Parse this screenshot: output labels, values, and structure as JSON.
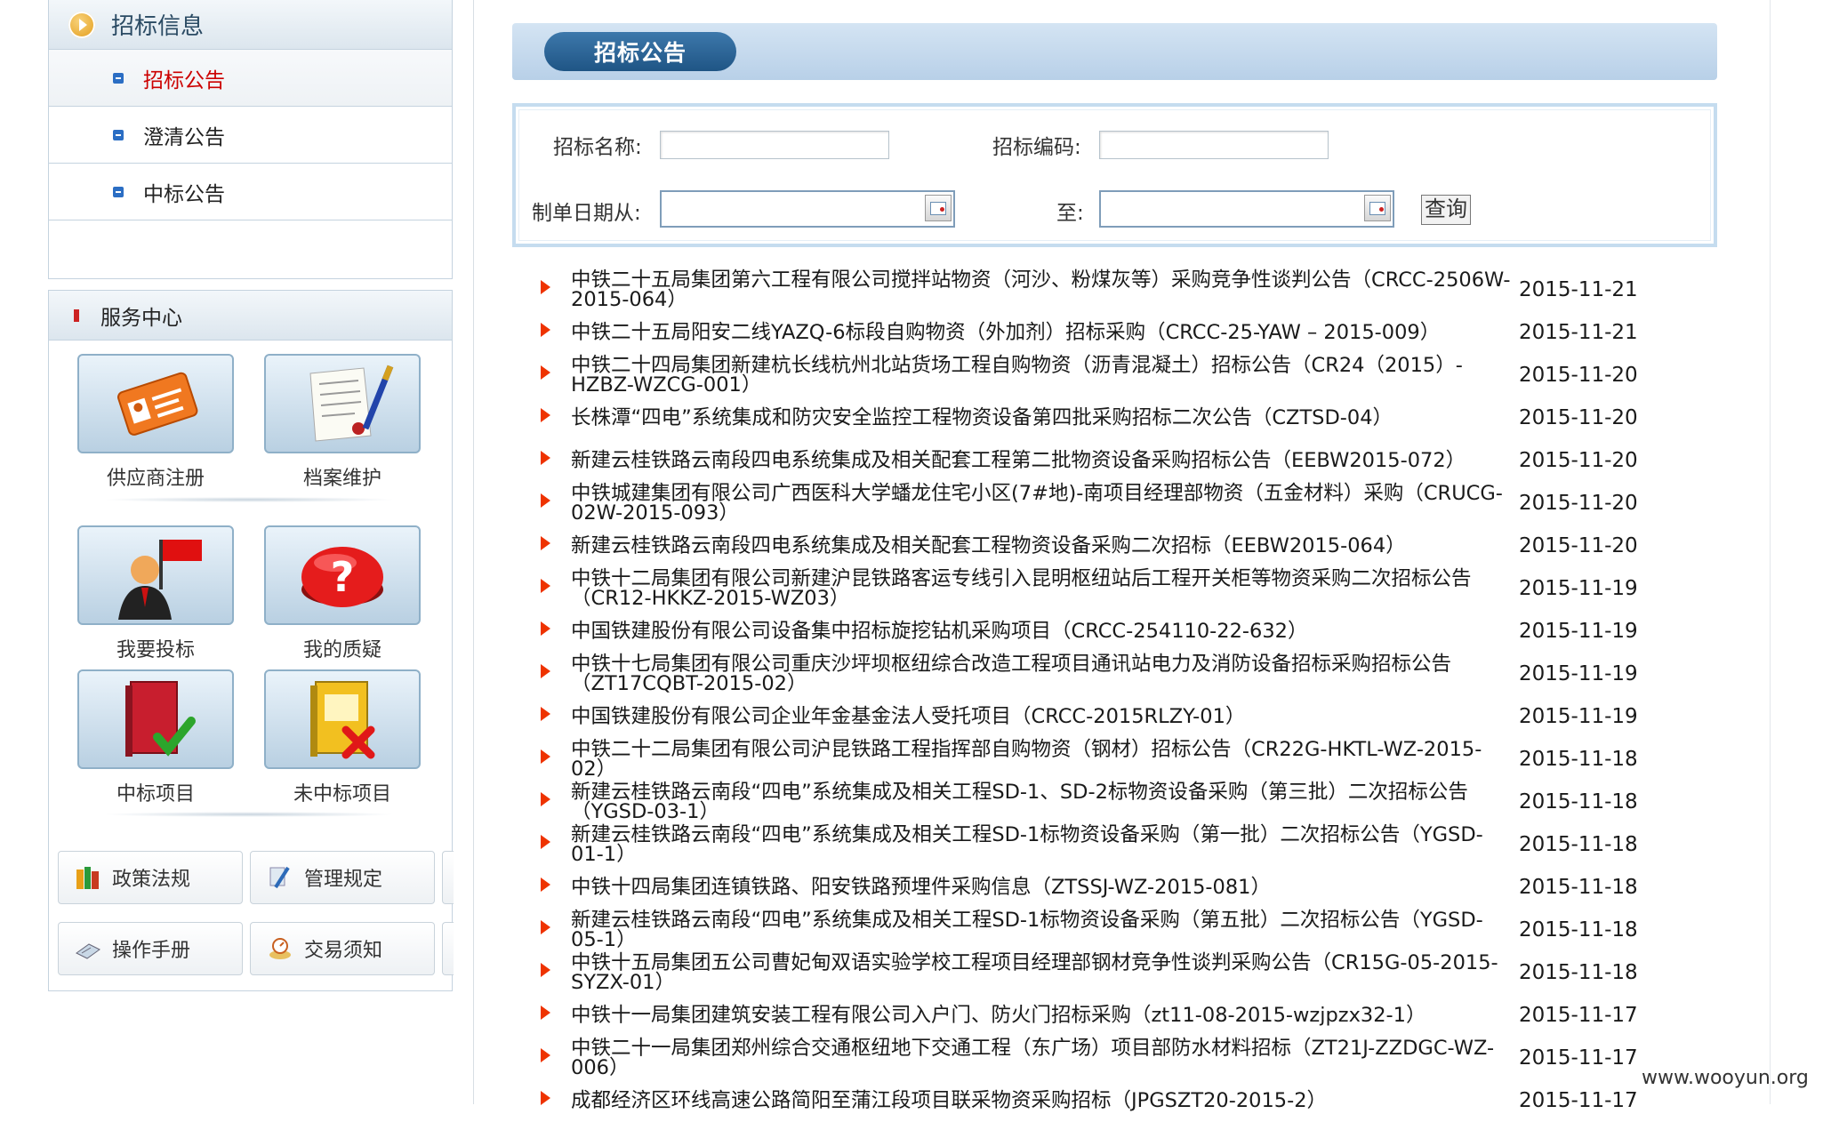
{
  "sidebar": {
    "section_title": "招标信息",
    "items": [
      {
        "label": "招标公告",
        "active": true
      },
      {
        "label": "澄清公告",
        "active": false
      },
      {
        "label": "中标公告",
        "active": false
      }
    ],
    "service_title": "服务中心",
    "services": [
      {
        "label": "供应商注册",
        "icon": "id-card-icon"
      },
      {
        "label": "档案维护",
        "icon": "document-pen-icon"
      },
      {
        "label": "我要投标",
        "icon": "person-flag-icon"
      },
      {
        "label": "我的质疑",
        "icon": "question-button-icon"
      },
      {
        "label": "中标项目",
        "icon": "book-check-icon"
      },
      {
        "label": "未中标项目",
        "icon": "book-cross-icon"
      }
    ],
    "links": [
      {
        "label": "政策法规",
        "icon": "books-icon"
      },
      {
        "label": "管理规定",
        "icon": "pen-icon"
      },
      {
        "label": "操作手册",
        "icon": "manual-icon"
      },
      {
        "label": "交易须知",
        "icon": "notice-icon"
      }
    ]
  },
  "main": {
    "banner_title": "招标公告",
    "search": {
      "name_label": "招标名称:",
      "code_label": "招标编码:",
      "date_from_label": "制单日期从:",
      "date_to_label": "至:",
      "query_button": "查询",
      "name_value": "",
      "code_value": "",
      "date_from_value": "",
      "date_to_value": ""
    },
    "notices": [
      {
        "title": "中铁二十五局集团第六工程有限公司搅拌站物资（河沙、粉煤灰等）采购竞争性谈判公告（CRCC-2506W-2015-064）",
        "date": "2015-11-21"
      },
      {
        "title": "中铁二十五局阳安二线YAZQ-6标段自购物资（外加剂）招标采购（CRCC-25-YAW – 2015-009）",
        "date": "2015-11-21"
      },
      {
        "title": "中铁二十四局集团新建杭长线杭州北站货场工程自购物资（沥青混凝土）招标公告（CR24（2015）-HZBZ-WZCG-001）",
        "date": "2015-11-20"
      },
      {
        "title": "长株潭“四电”系统集成和防灾安全监控工程物资设备第四批采购招标二次公告（CZTSD-04）",
        "date": "2015-11-20"
      },
      {
        "title": "新建云桂铁路云南段四电系统集成及相关配套工程第二批物资设备采购招标公告（EEBW2015-072）",
        "date": "2015-11-20"
      },
      {
        "title": "中铁城建集团有限公司广西医科大学蟠龙住宅小区(7#地)-南项目经理部物资（五金材料）采购（CRUCG-02W-2015-093）",
        "date": "2015-11-20"
      },
      {
        "title": "新建云桂铁路云南段四电系统集成及相关配套工程物资设备采购二次招标（EEBW2015-064）",
        "date": "2015-11-20"
      },
      {
        "title": "中铁十二局集团有限公司新建沪昆铁路客运专线引入昆明枢纽站后工程开关柜等物资采购二次招标公告（CR12-HKKZ-2015-WZ03）",
        "date": "2015-11-19"
      },
      {
        "title": "中国铁建股份有限公司设备集中招标旋挖钻机采购项目（CRCC-254110-22-632）",
        "date": "2015-11-19"
      },
      {
        "title": "中铁十七局集团有限公司重庆沙坪坝枢纽综合改造工程项目通讯站电力及消防设备招标采购招标公告（ZT17CQBT-2015-02）",
        "date": "2015-11-19"
      },
      {
        "title": "中国铁建股份有限公司企业年金基金法人受托项目（CRCC-2015RLZY-01）",
        "date": "2015-11-19"
      },
      {
        "title": "中铁二十二局集团有限公司沪昆铁路工程指挥部自购物资（钢材）招标公告（CR22G-HKTL-WZ-2015-02）",
        "date": "2015-11-18"
      },
      {
        "title": "新建云桂铁路云南段“四电”系统集成及相关工程SD-1、SD-2标物资设备采购（第三批）二次招标公告（YGSD-03-1）",
        "date": "2015-11-18"
      },
      {
        "title": "新建云桂铁路云南段“四电”系统集成及相关工程SD-1标物资设备采购（第一批）二次招标公告（YGSD-01-1）",
        "date": "2015-11-18"
      },
      {
        "title": "中铁十四局集团连镇铁路、阳安铁路预埋件采购信息（ZTSSJ-WZ-2015-081）",
        "date": "2015-11-18"
      },
      {
        "title": "新建云桂铁路云南段“四电”系统集成及相关工程SD-1标物资设备采购（第五批）二次招标公告（YGSD-05-1）",
        "date": "2015-11-18"
      },
      {
        "title": "中铁十五局集团五公司曹妃甸双语实验学校工程项目经理部钢材竞争性谈判采购公告（CR15G-05-2015-SYZX-01）",
        "date": "2015-11-18"
      },
      {
        "title": "中铁十一局集团建筑安装工程有限公司入户门、防火门招标采购（zt11-08-2015-wzjpzx32-1）",
        "date": "2015-11-17"
      },
      {
        "title": "中铁二十一局集团郑州综合交通枢纽地下交通工程（东广场）项目部防水材料招标（ZT21J-ZZDGC-WZ-006）",
        "date": "2015-11-17"
      },
      {
        "title": "成都经济区环线高速公路简阳至蒲江段项目联采物资采购招标（JPGSZT20-2015-2）",
        "date": "2015-11-17"
      }
    ]
  },
  "watermark": "www.wooyun.org",
  "colors": {
    "accent_red": "#cc0000",
    "arrow": "#ee3300",
    "banner_tab": "#1f5585"
  }
}
